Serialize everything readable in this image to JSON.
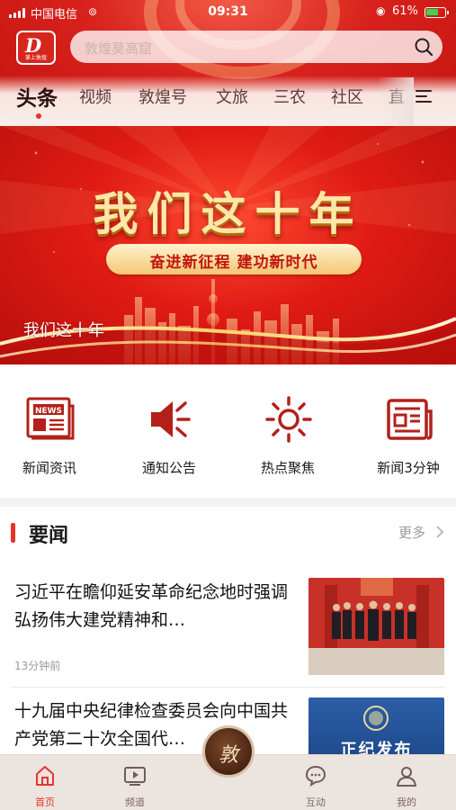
{
  "status_bar": {
    "carrier": "中国电信",
    "time": "09:31",
    "battery": "61%"
  },
  "header": {
    "logo": {
      "mark": "D",
      "subtitle": "掌上敦煌"
    },
    "search_placeholder": "敦煌莫高窟",
    "tabs": [
      "头条",
      "视频",
      "敦煌号",
      "文旅",
      "三农",
      "社区",
      "直"
    ]
  },
  "banner": {
    "title": "我们这十年",
    "slogan": "奋进新征程  建功新时代",
    "caption": "我们这十年"
  },
  "quick_entries": [
    {
      "label": "新闻资讯",
      "icon": "news-icon"
    },
    {
      "label": "通知公告",
      "icon": "speaker-icon"
    },
    {
      "label": "热点聚焦",
      "icon": "sun-icon"
    },
    {
      "label": "新闻3分钟",
      "icon": "newspaper-icon"
    }
  ],
  "news_section": {
    "title": "要闻",
    "more": "更多",
    "articles": [
      {
        "title": "习近平在瞻仰延安革命纪念地时强调 弘扬伟大建党精神和…",
        "time": "13分钟前"
      },
      {
        "title": "十九届中央纪律检查委员会向中国共产党第二十次全国代…",
        "thumb_text": "正纪发布"
      }
    ]
  },
  "bottom_nav": {
    "items": [
      {
        "label": "首页",
        "icon": "home-icon"
      },
      {
        "label": "频道",
        "icon": "play-icon"
      },
      {
        "label": "互动",
        "icon": "chat-icon"
      },
      {
        "label": "我的",
        "icon": "user-icon"
      }
    ],
    "center_glyph": "敦"
  },
  "colors": {
    "brand_red": "#e8332b",
    "banner_gold": "#ffe7a8"
  }
}
